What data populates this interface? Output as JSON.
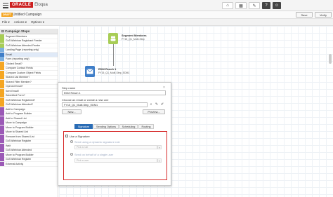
{
  "header": {
    "brand_oracle": "ORACLE",
    "brand_product": "Eloqua",
    "icons": [
      "home-icon",
      "grid-icon",
      "wrench-icon",
      "help-icon",
      "user-icon"
    ]
  },
  "titlebar": {
    "badge": "DRAFT",
    "campaign_name": "Untitled Campaign",
    "save_label": "Save",
    "verify_label": "Verify"
  },
  "menubar": {
    "file": "File ▾",
    "actions": "Actions ▾",
    "options": "Options ▾"
  },
  "steps_panel": {
    "title": "Campaign Steps",
    "items": [
      {
        "label": "Segment Members",
        "color": "#a8cd56"
      },
      {
        "label": "GoToWebinar Registrant Feeder",
        "color": "#a8cd56"
      },
      {
        "label": "GoToWebinar Attended Feeder",
        "color": "#a8cd56"
      },
      {
        "label": "Landing Page (reporting only)",
        "color": "#7db0e0"
      },
      {
        "label": "Email",
        "color": "#3f7ec8"
      },
      {
        "label": "Form (reporting only)",
        "color": "#7db0e0"
      },
      {
        "label": "Clicked Email?",
        "color": "#f5a623"
      },
      {
        "label": "Compare Contact Fields",
        "color": "#f5a623"
      },
      {
        "label": "Compare Custom Object Fields",
        "color": "#f5a623"
      },
      {
        "label": "Shared List Member?",
        "color": "#f5a623"
      },
      {
        "label": "Shared Filter Member?",
        "color": "#f5a623"
      },
      {
        "label": "Opened Email?",
        "color": "#f5a623"
      },
      {
        "label": "Sent Email?",
        "color": "#f5a623"
      },
      {
        "label": "Submitted Form?",
        "color": "#f5a623"
      },
      {
        "label": "GoToWebinar Registered?",
        "color": "#f5a623"
      },
      {
        "label": "GoToWebinar Attended?",
        "color": "#f5a623"
      },
      {
        "label": "Add to Campaign",
        "color": "#9b59b6"
      },
      {
        "label": "Add to Program Builder",
        "color": "#9b59b6"
      },
      {
        "label": "Add to Shared List",
        "color": "#9b59b6"
      },
      {
        "label": "Move to Campaign",
        "color": "#9b59b6"
      },
      {
        "label": "Move to Program Builder",
        "color": "#9b59b6"
      },
      {
        "label": "Move to Shared List",
        "color": "#9b59b6"
      },
      {
        "label": "Remove from Shared List",
        "color": "#9b59b6"
      },
      {
        "label": "GoToWebinar Register",
        "color": "#9b59b6"
      },
      {
        "label": "Wait",
        "color": "#9b59b6"
      },
      {
        "label": "GoToWebinar Attended",
        "color": "#9b59b6"
      },
      {
        "label": "Move to Program Builder",
        "color": "#9b59b6"
      },
      {
        "label": "GoToWebinar Register",
        "color": "#9b59b6"
      },
      {
        "label": "External Activity",
        "color": "#9b59b6"
      }
    ]
  },
  "canvas": {
    "segment_node": {
      "title": "Segment Members",
      "subtitle": "FY15_Q1_Multi-Step",
      "color": "#a8cd56"
    },
    "email_node": {
      "title": "EDM Reach 1",
      "subtitle": "FY15_Q1_Multi-Step_EDM1",
      "color": "#3f7ec8"
    }
  },
  "step_config": {
    "step_name_label": "Step name",
    "step_name_value": "EDM Reach 1",
    "choose_label": "Choose an email or create a new one",
    "email_value": "FY15_Q1_Multi-Step_EDM1",
    "new_button": "New...",
    "preview_button": "Preview...",
    "tabs": [
      "Signature",
      "Sending Options",
      "Scheduling",
      "Routing"
    ],
    "use_signature_label": "Use a Signature",
    "option_dynamic": "Send using a dynamic signature rule",
    "option_dynamic_placeholder": "Pick a rule",
    "option_single": "Send on behalf of a single user",
    "option_single_placeholder": "Pick a user"
  }
}
